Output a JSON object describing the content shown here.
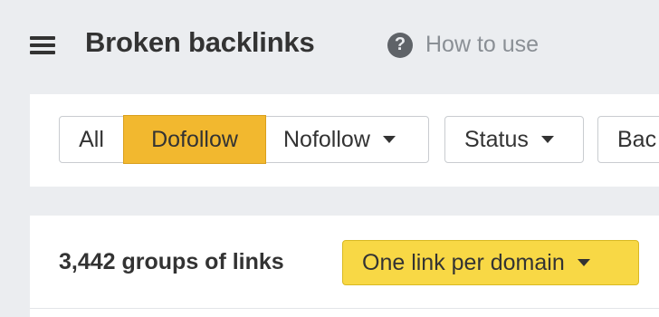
{
  "header": {
    "title": "Broken backlinks",
    "help_label": "How to use",
    "help_icon": "question-circle-icon",
    "menu_icon": "hamburger-menu-icon"
  },
  "filters": {
    "link_type": {
      "options": [
        "All",
        "Dofollow",
        "Nofollow"
      ],
      "selected": "Dofollow"
    },
    "status_label": "Status",
    "partial_label": "Bac"
  },
  "results": {
    "count_label": "3,442 groups of links",
    "grouping_label": "One link per domain"
  },
  "colors": {
    "background": "#ebedf0",
    "panel": "#ffffff",
    "selected_segment": "#f2b82f",
    "grouping_button": "#f8d845",
    "text": "#333333",
    "muted_text": "#8a8f95"
  }
}
